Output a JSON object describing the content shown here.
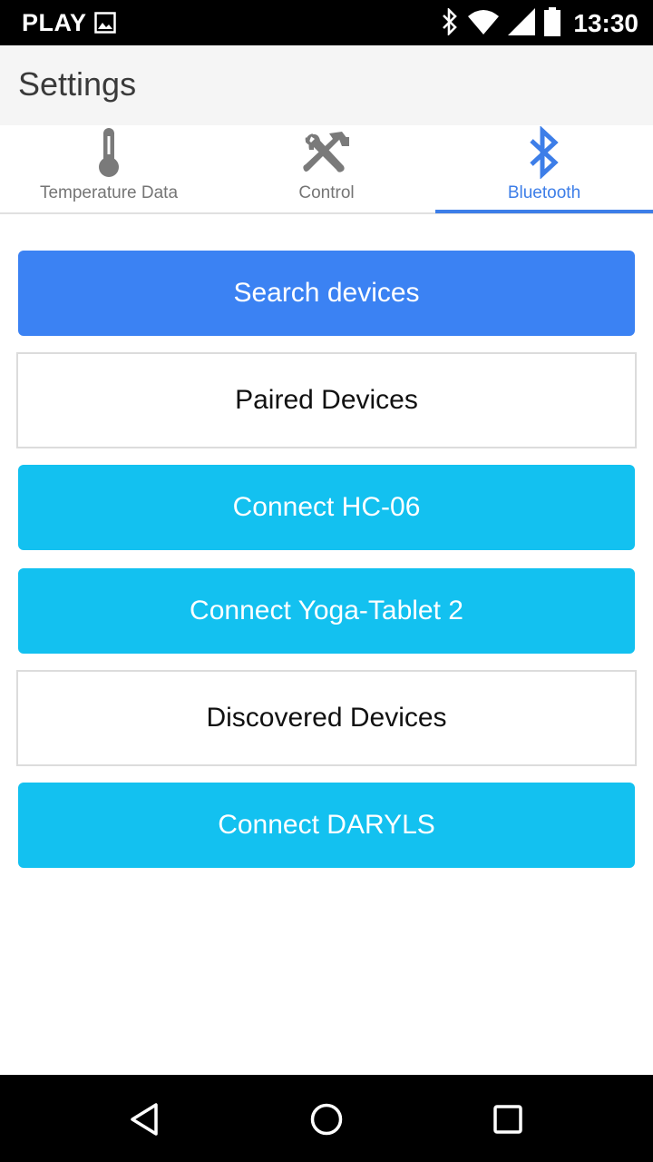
{
  "status_bar": {
    "carrier": "PLAY",
    "time": "13:30",
    "icons": [
      "image-icon",
      "bluetooth-icon",
      "wifi-icon",
      "signal-icon",
      "battery-icon"
    ]
  },
  "app_bar": {
    "title": "Settings"
  },
  "tabs": [
    {
      "label": "Temperature Data",
      "icon": "thermometer-icon",
      "active": false
    },
    {
      "label": "Control",
      "icon": "tools-icon",
      "active": false
    },
    {
      "label": "Bluetooth",
      "icon": "bluetooth-icon",
      "active": true
    }
  ],
  "content": {
    "search_button": "Search devices",
    "paired_header": "Paired Devices",
    "paired_devices": [
      "Connect HC-06",
      "Connect Yoga-Tablet 2"
    ],
    "discovered_header": "Discovered Devices",
    "discovered_devices": [
      "Connect DARYLS"
    ]
  },
  "nav_bar": {
    "icons": [
      "back-icon",
      "home-icon",
      "recents-icon"
    ]
  },
  "colors": {
    "accent": "#3d7ee8",
    "primary_button": "#3b82f3",
    "device_button": "#13c1f0",
    "inactive_tab": "#757575"
  }
}
